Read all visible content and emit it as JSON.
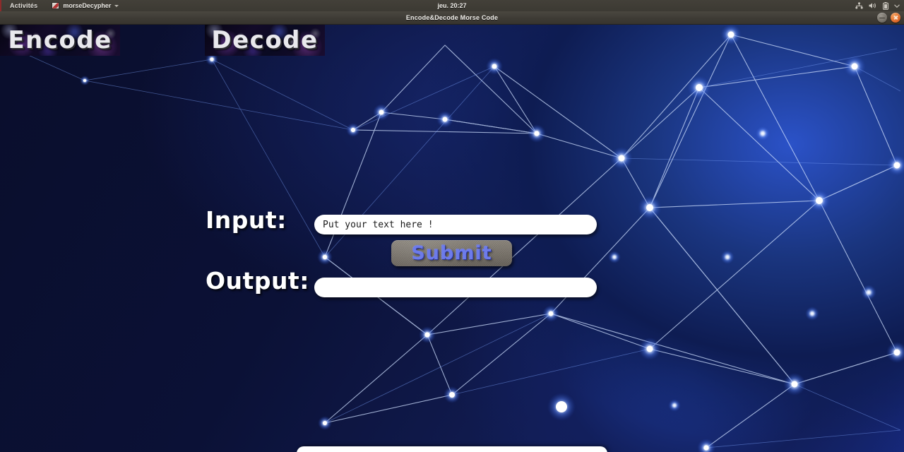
{
  "desktop": {
    "topbar": {
      "activities_label": "Activités",
      "app_name": "morseDecypher",
      "app_icon": "window-icon",
      "caret_icon": "chevron-down-icon",
      "clock": "jeu. 20:27",
      "indicators": [
        {
          "name": "network-icon",
          "label": "Network"
        },
        {
          "name": "volume-icon",
          "label": "Volume"
        },
        {
          "name": "battery-icon",
          "label": "Battery"
        },
        {
          "name": "system-menu-chevron-down-icon",
          "label": "System menu"
        }
      ]
    },
    "window": {
      "title": "Encode&Decode Morse Code",
      "minimize_icon": "minimize-icon",
      "close_icon": "close-icon"
    }
  },
  "page": {
    "banners": [
      {
        "id": "encode",
        "label": "Encode"
      },
      {
        "id": "decode",
        "label": "Decode"
      }
    ],
    "form": {
      "input_label": "Input:",
      "input_placeholder": "Put your text here !",
      "input_value": "",
      "submit_label": "Submit",
      "output_label": "Output:",
      "output_value": ""
    },
    "colors": {
      "page_background": "#0b1034",
      "network_glow": "#2b52c8",
      "field_background": "#ffffff",
      "submit_text": "#6d7bea",
      "submit_face": "#79736a",
      "label_text": "#ffffff",
      "topbar_background": "#3c3a33",
      "close_button": "#e06c2c"
    }
  }
}
